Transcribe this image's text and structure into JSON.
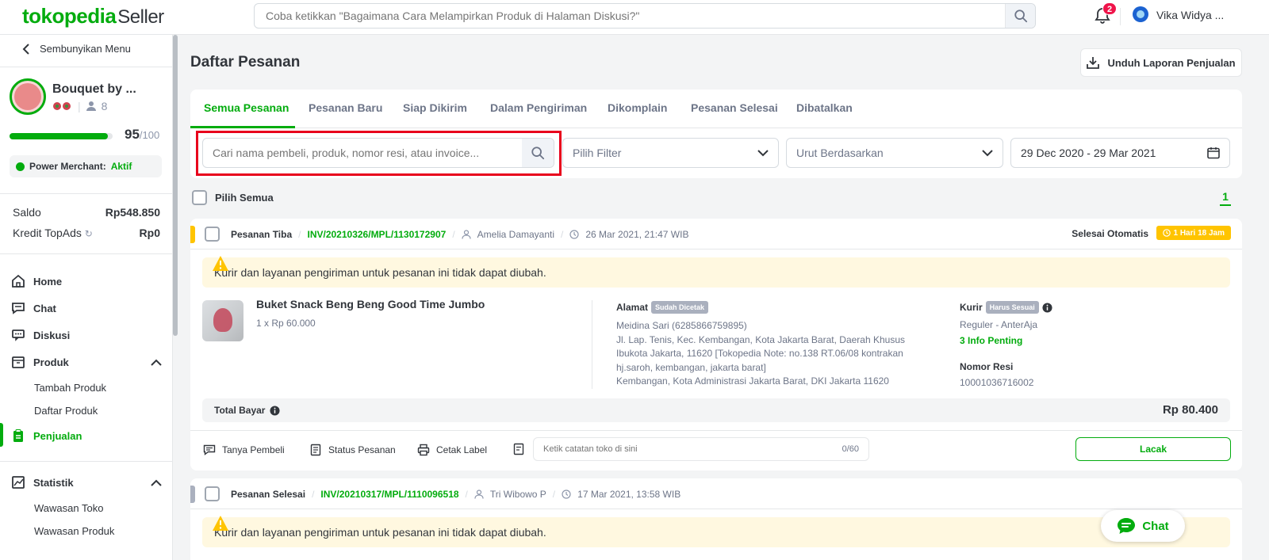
{
  "header": {
    "logo_brand": "tokopedia",
    "logo_suffix": "Seller",
    "search_placeholder": "Coba ketikkan \"Bagaimana Cara Melampirkan Produk di Halaman Diskusi?\"",
    "notification_count": "2",
    "user_name": "Vika Widya ..."
  },
  "sidebar": {
    "hide_menu_label": "Sembunyikan Menu",
    "shop_name": "Bouquet by ...",
    "follower_count": "8",
    "score": "95",
    "score_max": "/100",
    "score_fraction": 0.95,
    "power_merchant_label": "Power Merchant:",
    "power_merchant_status": "Aktif",
    "saldo_label": "Saldo",
    "saldo_value": "Rp548.850",
    "topads_label": "Kredit TopAds",
    "topads_value": "Rp0",
    "nav": {
      "home": "Home",
      "chat": "Chat",
      "diskusi": "Diskusi",
      "produk": "Produk",
      "tambah_produk": "Tambah Produk",
      "daftar_produk": "Daftar Produk",
      "penjualan": "Penjualan",
      "statistik": "Statistik",
      "wawasan_toko": "Wawasan Toko",
      "wawasan_produk": "Wawasan Produk"
    }
  },
  "main": {
    "title": "Daftar Pesanan",
    "download_label": "Unduh Laporan Penjualan",
    "tabs": [
      {
        "label": "Semua Pesanan"
      },
      {
        "label": "Pesanan Baru"
      },
      {
        "label": "Siap Dikirim"
      },
      {
        "label": "Dalam Pengiriman"
      },
      {
        "label": "Dikomplain"
      },
      {
        "label": "Pesanan Selesai"
      },
      {
        "label": "Dibatalkan"
      }
    ],
    "search_placeholder": "Cari nama pembeli, produk, nomor resi, atau invoice...",
    "filter_placeholder": "Pilih Filter",
    "sort_placeholder": "Urut Berdasarkan",
    "date_range": "29 Dec 2020 - 29 Mar 2021",
    "select_all_label": "Pilih Semua",
    "page_number": "1"
  },
  "orders": [
    {
      "status": "Pesanan Tiba",
      "invoice": "INV/20210326/MPL/1130172907",
      "buyer": "Amelia Damayanti",
      "date": "26 Mar 2021, 21:47 WIB",
      "auto_done_label": "Selesai Otomatis",
      "timer": "1 Hari 18 Jam",
      "warning": "Kurir dan layanan pengiriman untuk pesanan ini tidak dapat diubah.",
      "product_name": "Buket Snack Beng Beng Good Time Jumbo",
      "product_qty": "1 x Rp 60.000",
      "address_label": "Alamat",
      "address_tag": "Sudah Dicetak",
      "address_name": "Meidina Sari (6285866759895)",
      "address_line1": "Jl. Lap. Tenis, Kec. Kembangan, Kota Jakarta Barat, Daerah Khusus",
      "address_line2": "Ibukota Jakarta, 11620 [Tokopedia Note: no.138 RT.06/08 kontrakan",
      "address_line3": "hj.saroh, kembangan, jakarta barat]",
      "address_line4": "Kembangan, Kota Administrasi Jakarta Barat, DKI Jakarta 11620",
      "courier_label": "Kurir",
      "courier_tag": "Harus Sesuai",
      "courier_value": "Reguler - AnterAja",
      "info_penting": "3 Info Penting",
      "resi_label": "Nomor Resi",
      "resi_value": "10001036716002",
      "total_label": "Total Bayar",
      "total_value": "Rp 80.400",
      "action_ask": "Tanya Pembeli",
      "action_status": "Status Pesanan",
      "action_print": "Cetak Label",
      "note_placeholder": "Ketik catatan toko di sini",
      "note_count": "0/60",
      "track_label": "Lacak"
    },
    {
      "status": "Pesanan Selesai",
      "invoice": "INV/20210317/MPL/1110096518",
      "buyer": "Tri Wibowo P",
      "date": "17 Mar 2021, 13:58 WIB",
      "warning": "Kurir dan layanan pengiriman untuk pesanan ini tidak dapat diubah."
    }
  ],
  "chat_float_label": "Chat",
  "colors": {
    "brand_green": "#03ac0e",
    "highlight_red": "#e8001c",
    "timer_yellow": "#ffc400",
    "warning_bg": "#fff8e0"
  }
}
